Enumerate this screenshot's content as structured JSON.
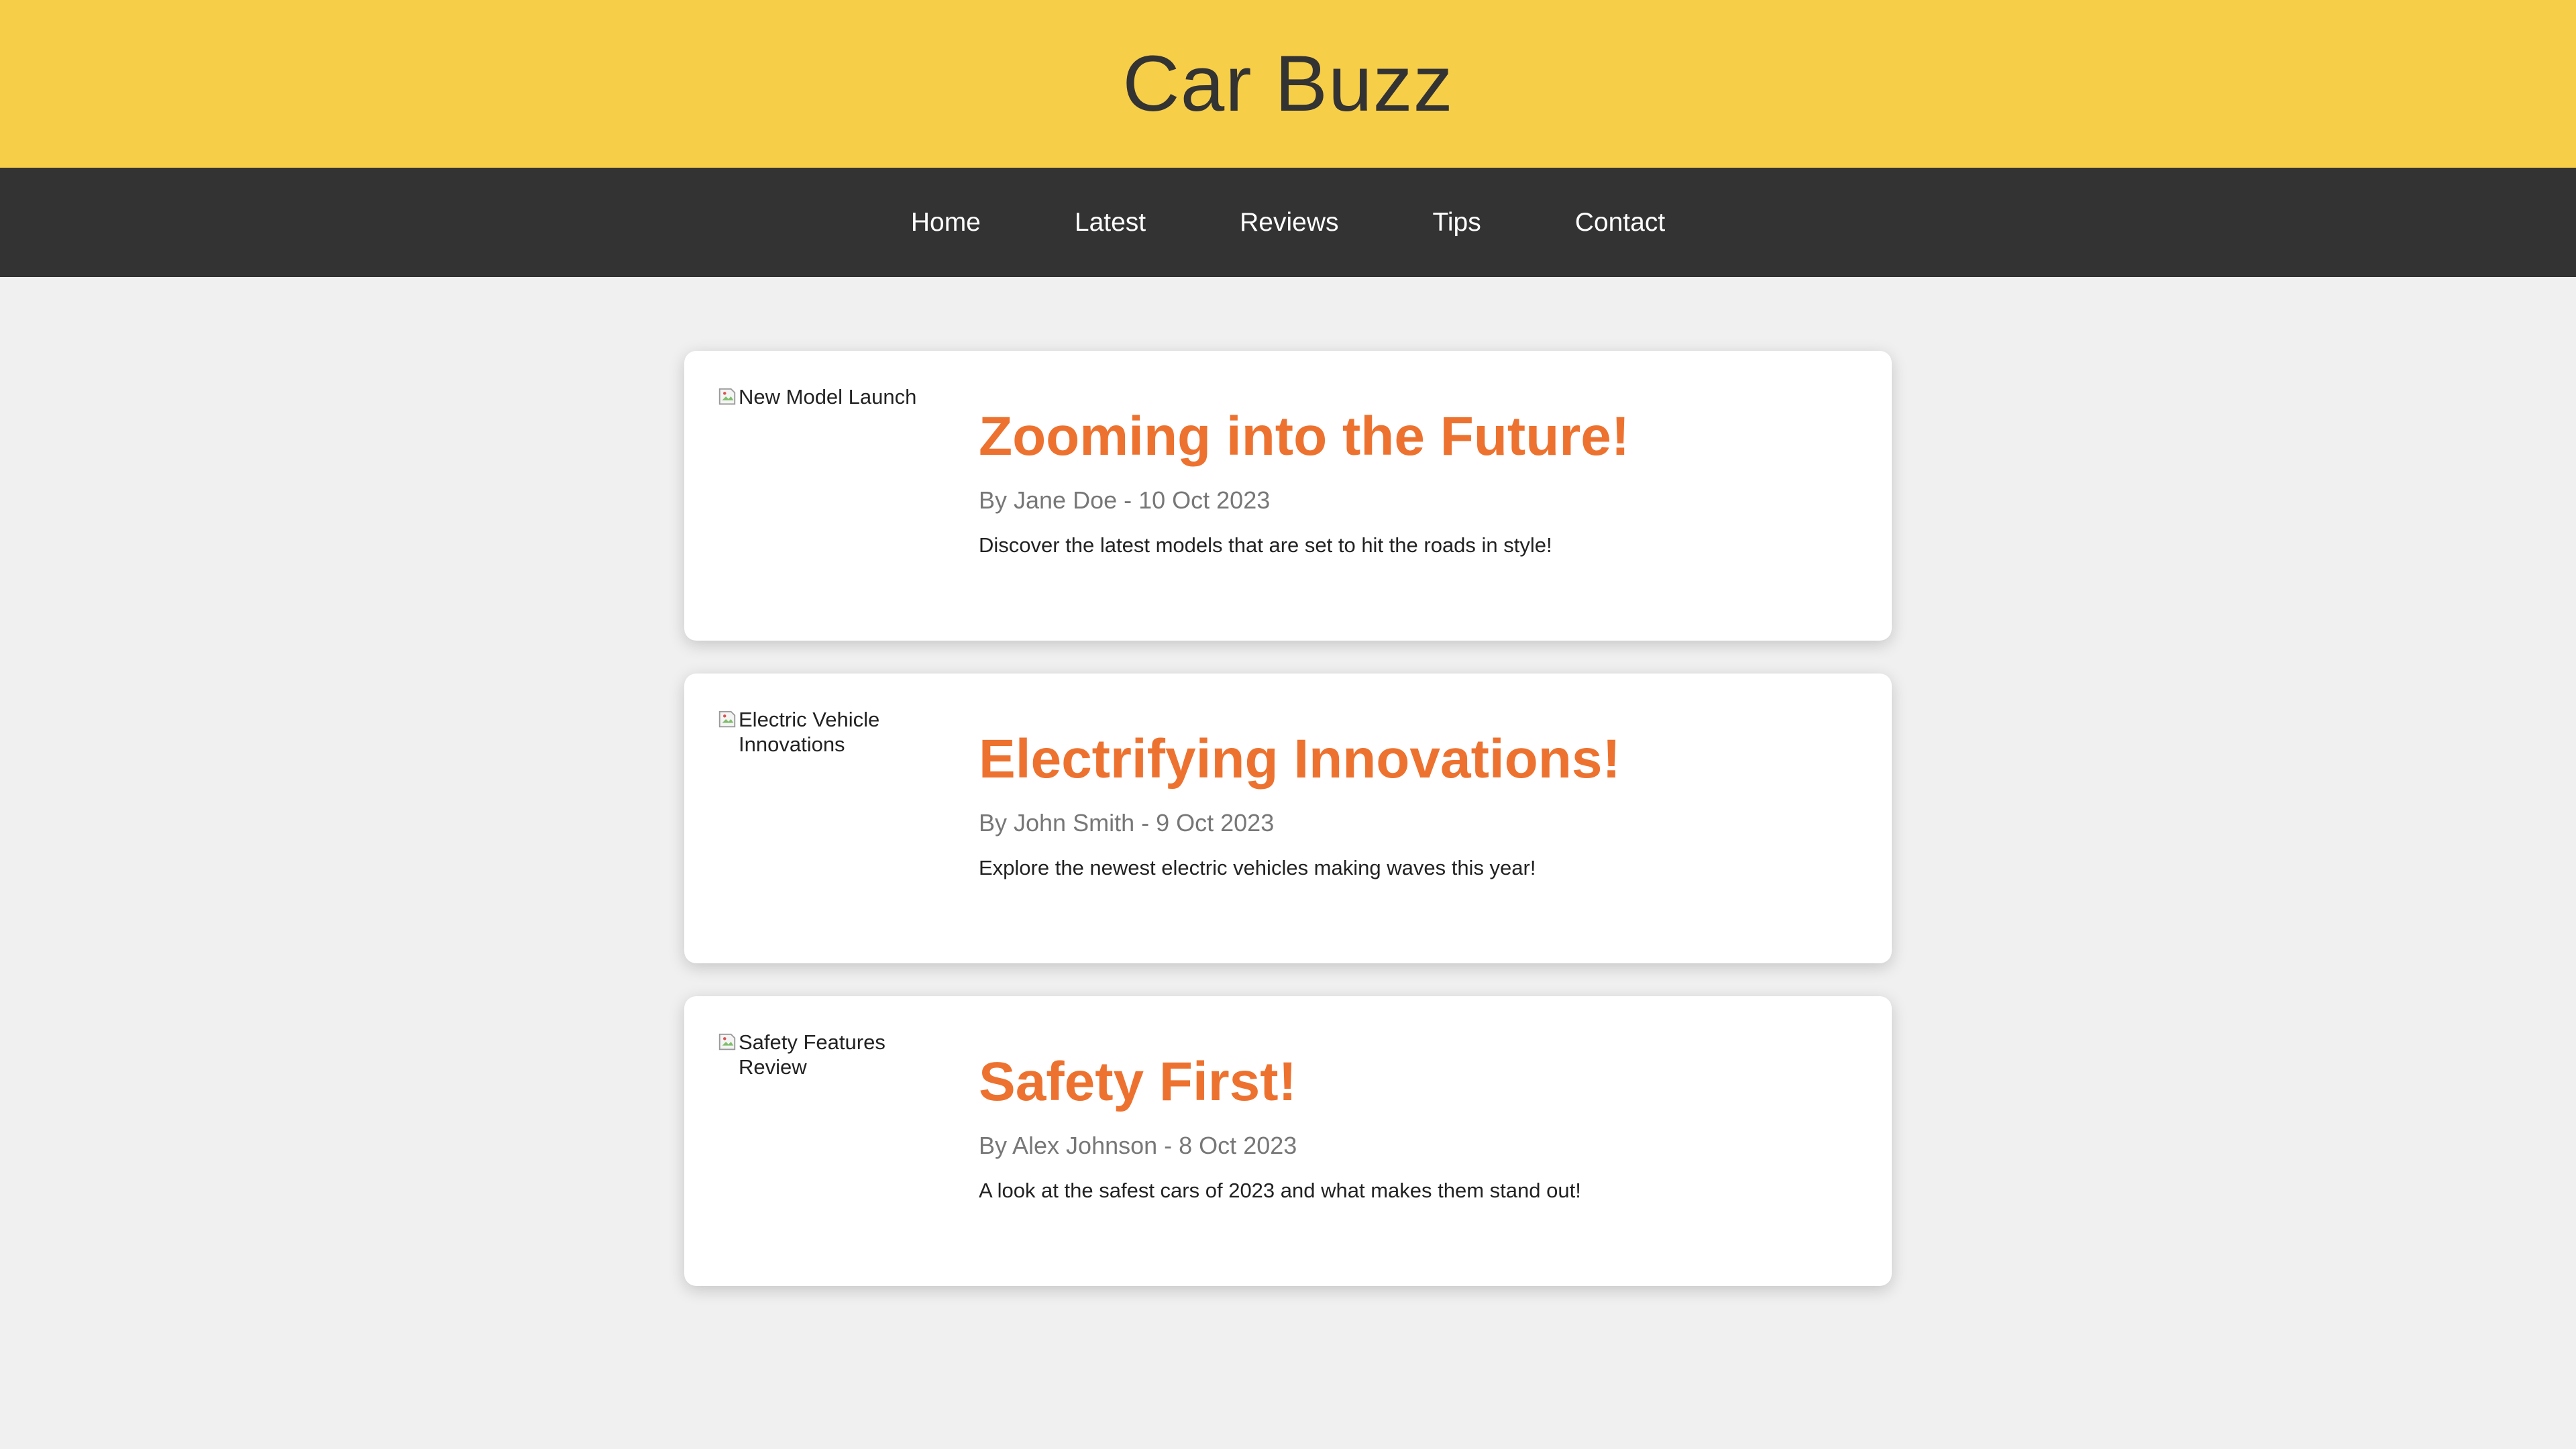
{
  "header": {
    "site_title": "Car Buzz"
  },
  "nav": {
    "items": [
      {
        "label": "Home"
      },
      {
        "label": "Latest"
      },
      {
        "label": "Reviews"
      },
      {
        "label": "Tips"
      },
      {
        "label": "Contact"
      }
    ]
  },
  "articles": [
    {
      "image_alt": "New Model Launch",
      "title": "Zooming into the Future!",
      "meta": "By Jane Doe - 10 Oct 2023",
      "excerpt": "Discover the latest models that are set to hit the roads in style!"
    },
    {
      "image_alt": "Electric Vehicle Innovations",
      "title": "Electrifying Innovations!",
      "meta": "By John Smith - 9 Oct 2023",
      "excerpt": "Explore the newest electric vehicles making waves this year!"
    },
    {
      "image_alt": "Safety Features Review",
      "title": "Safety First!",
      "meta": "By Alex Johnson - 8 Oct 2023",
      "excerpt": "A look at the safest cars of 2023 and what makes them stand out!"
    }
  ],
  "colors": {
    "header_bg": "#f7ce48",
    "nav_bg": "#333333",
    "accent": "#ed722f",
    "page_bg": "#f0f0f0"
  },
  "icons": {
    "broken_image": "broken-image-icon"
  }
}
